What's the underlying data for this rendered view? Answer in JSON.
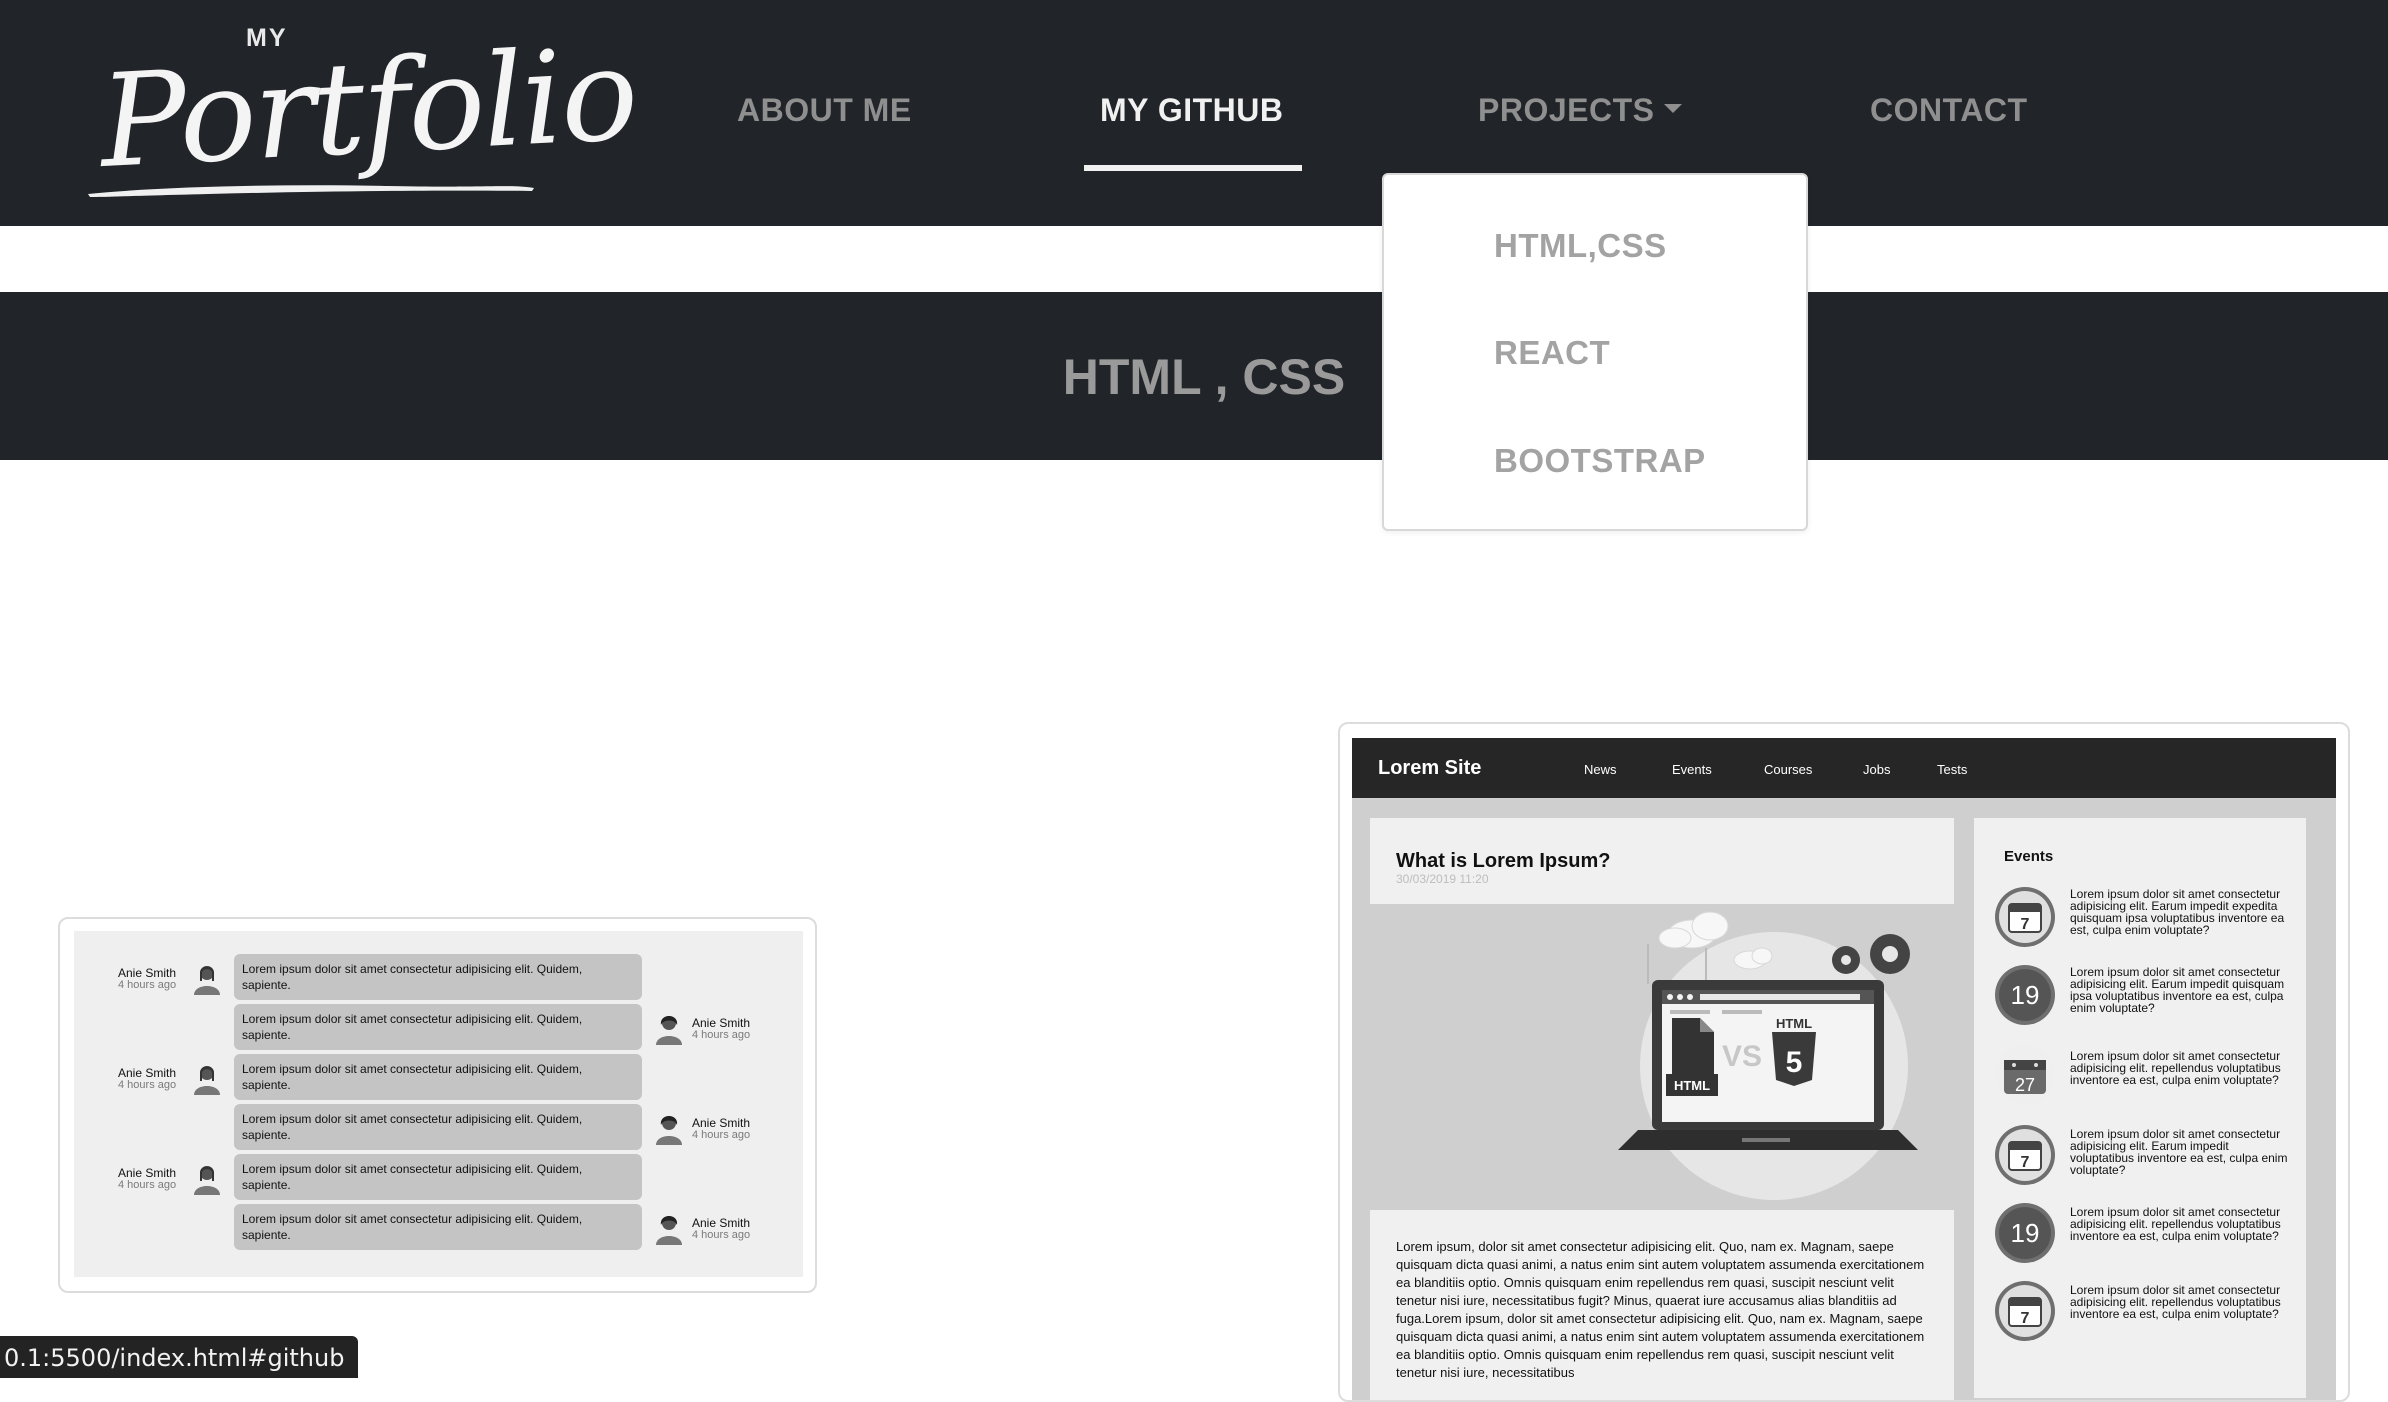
{
  "logo": {
    "small": "MY",
    "script": "Portfolio"
  },
  "nav": {
    "items": [
      {
        "label": "ABOUT ME"
      },
      {
        "label": "MY GITHUB"
      },
      {
        "label": "PROJECTS"
      },
      {
        "label": "CONTACT"
      }
    ],
    "active": "MY GITHUB"
  },
  "dropdown": {
    "items": [
      "HTML,CSS",
      "REACT",
      "BOOTSTRAP"
    ]
  },
  "section": {
    "title": "HTML , CSS"
  },
  "chat_preview": {
    "messages": [
      {
        "name": "Anie Smith",
        "time": "4 hours ago",
        "side": "left",
        "text": "Lorem ipsum dolor sit amet consectetur adipisicing elit. Quidem, sapiente."
      },
      {
        "name": "Anie Smith",
        "time": "4 hours ago",
        "side": "right",
        "text": "Lorem ipsum dolor sit amet consectetur adipisicing elit. Quidem, sapiente."
      },
      {
        "name": "Anie Smith",
        "time": "4 hours ago",
        "side": "left",
        "text": "Lorem ipsum dolor sit amet consectetur adipisicing elit. Quidem, sapiente."
      },
      {
        "name": "Anie Smith",
        "time": "4 hours ago",
        "side": "right",
        "text": "Lorem ipsum dolor sit amet consectetur adipisicing elit. Quidem, sapiente."
      },
      {
        "name": "Anie Smith",
        "time": "4 hours ago",
        "side": "left",
        "text": "Lorem ipsum dolor sit amet consectetur adipisicing elit. Quidem, sapiente."
      },
      {
        "name": "Anie Smith",
        "time": "4 hours ago",
        "side": "right",
        "text": "Lorem ipsum dolor sit amet consectetur adipisicing elit. Quidem, sapiente."
      }
    ]
  },
  "site_preview": {
    "brand": "Lorem Site",
    "links": [
      "News",
      "Events",
      "Courses",
      "Jobs",
      "Tests"
    ],
    "article": {
      "title": "What is Lorem Ipsum?",
      "date": "30/03/2019 11:20",
      "image_labels": {
        "left": "HTML",
        "vs": "VS",
        "right": "HTML",
        "number": "5"
      },
      "text": "Lorem ipsum, dolor sit amet consectetur adipisicing elit. Quo, nam ex. Magnam, saepe quisquam dicta quasi animi, a natus enim sint autem voluptatem assumenda exercitationem ea blanditiis optio. Omnis quisquam enim repellendus rem quasi, suscipit nesciunt velit tenetur nisi iure, necessitatibus fugit? Minus, quaerat iure accusamus alias blanditiis ad fuga.Lorem ipsum, dolor sit amet consectetur adipisicing elit. Quo, nam ex. Magnam, saepe quisquam dicta quasi animi, a natus enim sint autem voluptatem assumenda exercitationem ea blanditiis optio. Omnis quisquam enim repellendus rem quasi, suscipit nesciunt velit tenetur nisi iure, necessitatibus"
    },
    "events": {
      "title": "Events",
      "items": [
        {
          "day": "7",
          "style": "calendar",
          "text": "Lorem ipsum dolor sit amet consectetur adipisicing elit. Earum impedit expedita quisquam ipsa voluptatibus inventore ea est, culpa enim voluptate?"
        },
        {
          "day": "19",
          "style": "circle",
          "text": "Lorem ipsum dolor sit amet consectetur adipisicing elit. Earum impedit quisquam ipsa voluptatibus inventore ea est, culpa enim voluptate?"
        },
        {
          "day": "27",
          "style": "calendar-plain",
          "text": "Lorem ipsum dolor sit amet consectetur adipisicing elit. repellendus voluptatibus inventore ea est, culpa enim voluptate?"
        },
        {
          "day": "7",
          "style": "calendar",
          "text": "Lorem ipsum dolor sit amet consectetur adipisicing elit. Earum impedit voluptatibus inventore ea est, culpa enim voluptate?"
        },
        {
          "day": "19",
          "style": "circle",
          "text": "Lorem ipsum dolor sit amet consectetur adipisicing elit. repellendus voluptatibus inventore ea est, culpa enim voluptate?"
        },
        {
          "day": "7",
          "style": "calendar",
          "text": "Lorem ipsum dolor sit amet consectetur adipisicing elit. repellendus voluptatibus inventore ea est, culpa enim voluptate?"
        }
      ]
    }
  },
  "status_bar": {
    "url": "0.1:5500/index.html#github"
  },
  "colors": {
    "navbar": "#212529",
    "nav_inactive": "#8f8f8f",
    "nav_active": "#f1f1f1",
    "dropdown_text": "#a3a3a3"
  }
}
